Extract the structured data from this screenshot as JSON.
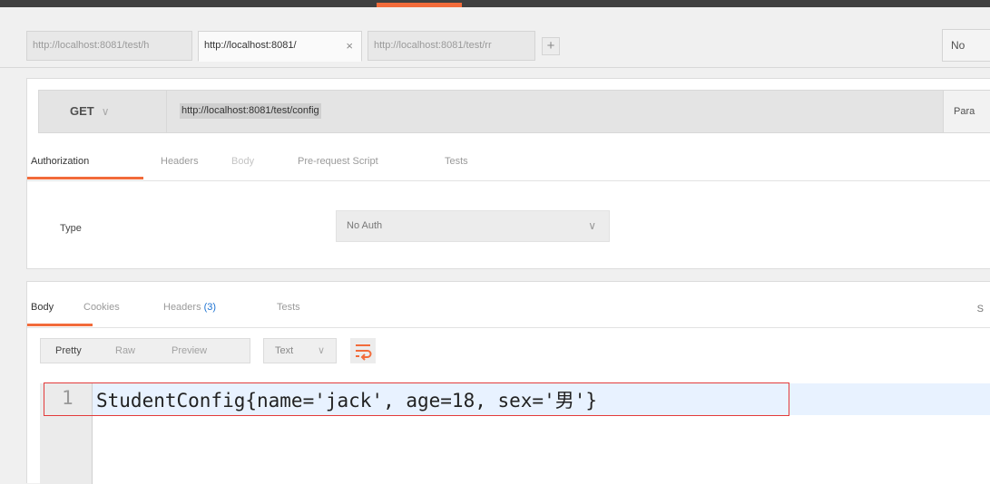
{
  "colors": {
    "accent": "#f26b3a",
    "highlight_box": "#e33b3b",
    "header_count": "#1e73d2"
  },
  "tabs": [
    {
      "label": "http://localhost:8081/test/h",
      "active": false
    },
    {
      "label": "http://localhost:8081/",
      "active": true,
      "close": "×"
    },
    {
      "label": "http://localhost:8081/test/rr",
      "active": false
    }
  ],
  "tab_add": "+",
  "environment": {
    "label": "No"
  },
  "request": {
    "method": "GET",
    "method_chevron": "∨",
    "url": "http://localhost:8081/test/config",
    "params_label": "Para"
  },
  "request_tabs": [
    {
      "label": "Authorization",
      "active": true
    },
    {
      "label": "Headers"
    },
    {
      "label": "Body"
    },
    {
      "label": "Pre-request Script"
    },
    {
      "label": "Tests"
    }
  ],
  "auth": {
    "type_label": "Type",
    "type_value": "No Auth",
    "chevron": "∨"
  },
  "response_tabs": {
    "body": "Body",
    "cookies": "Cookies",
    "headers": "Headers",
    "headers_count": "(3)",
    "tests": "Tests",
    "status_cut": "S"
  },
  "view_buttons": [
    "Pretty",
    "Raw",
    "Preview"
  ],
  "format": {
    "label": "Text",
    "chevron": "∨"
  },
  "editor": {
    "line_number": "1",
    "content": "StudentConfig{name='jack', age=18, sex='男'}"
  }
}
